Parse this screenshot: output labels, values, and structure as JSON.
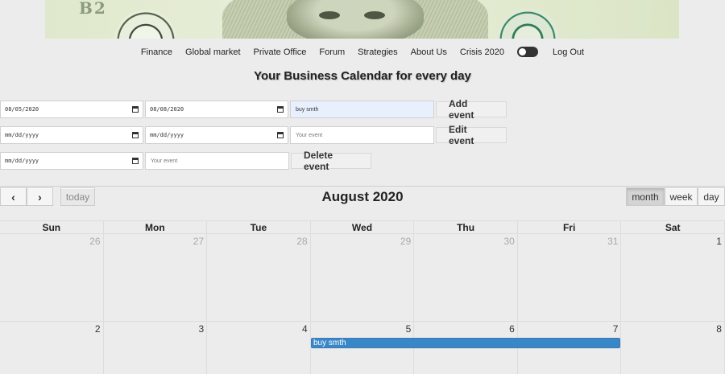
{
  "banner": {
    "serial_text": "B2"
  },
  "nav": {
    "items": [
      "Finance",
      "Global market",
      "Private Office",
      "Forum",
      "Strategies",
      "About Us",
      "Crisis 2020"
    ],
    "logout": "Log Out"
  },
  "heading": "Your Business Calendar for every day",
  "forms": {
    "add": {
      "start": "08/05/2020",
      "end": "08/08/2020",
      "event": "buy smth",
      "button": "Add event"
    },
    "edit": {
      "start": "mm/dd/yyyy",
      "end": "mm/dd/yyyy",
      "event_placeholder": "Your event",
      "button": "Edit event"
    },
    "delete": {
      "date": "mm/dd/yyyy",
      "event_placeholder": "Your event",
      "button": "Delete event"
    }
  },
  "calendar": {
    "prev": "‹",
    "next": "›",
    "today": "today",
    "title": "August 2020",
    "views": {
      "month": "month",
      "week": "week",
      "day": "day"
    },
    "weekdays": [
      "Sun",
      "Mon",
      "Tue",
      "Wed",
      "Thu",
      "Fri",
      "Sat"
    ],
    "weeks": [
      [
        "26",
        "27",
        "28",
        "29",
        "30",
        "31",
        "1"
      ],
      [
        "2",
        "3",
        "4",
        "5",
        "6",
        "7",
        "8"
      ]
    ],
    "event": {
      "title": "buy smth",
      "color": "#3a87c8"
    }
  }
}
